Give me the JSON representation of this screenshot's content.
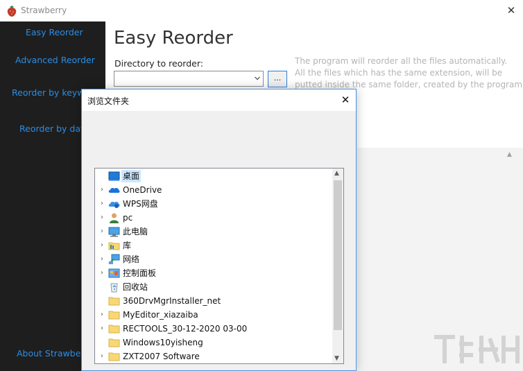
{
  "app": {
    "title": "Strawberry",
    "close_glyph": "✕"
  },
  "sidebar": {
    "items": [
      {
        "label": "Easy Reorder"
      },
      {
        "label": "Advanced Reorder"
      },
      {
        "label": "Reorder by keyword"
      },
      {
        "label": "Reorder by date"
      },
      {
        "label": "About Strawberry"
      }
    ]
  },
  "main": {
    "title": "Easy Reorder",
    "dir_label": "Directory to reorder:",
    "dir_value": "",
    "browse_label": "...",
    "info_lines": [
      "The program will reorder all the files automatically.",
      "All the files which has the same extension, will be",
      "putted inside the same folder, created by the program."
    ]
  },
  "dialog": {
    "title": "浏览文件夹",
    "close_glyph": "✕",
    "tree": [
      {
        "label": "桌面",
        "icon": "desktop-icon",
        "expandable": false,
        "selected": true
      },
      {
        "label": "OneDrive",
        "icon": "onedrive-cloud-icon",
        "expandable": true
      },
      {
        "label": "WPS网盘",
        "icon": "wps-cloud-icon",
        "expandable": true
      },
      {
        "label": "pc",
        "icon": "user-icon",
        "expandable": true
      },
      {
        "label": "此电脑",
        "icon": "computer-icon",
        "expandable": true
      },
      {
        "label": "库",
        "icon": "library-icon",
        "expandable": true
      },
      {
        "label": "网络",
        "icon": "network-icon",
        "expandable": true
      },
      {
        "label": "控制面板",
        "icon": "control-panel-icon",
        "expandable": true
      },
      {
        "label": "回收站",
        "icon": "recycle-bin-icon",
        "expandable": false
      },
      {
        "label": "360DrvMgrInstaller_net",
        "icon": "folder-icon",
        "expandable": false
      },
      {
        "label": "MyEditor_xiazaiba",
        "icon": "folder-icon",
        "expandable": true
      },
      {
        "label": "RECTOOLS_30-12-2020 03-00",
        "icon": "folder-icon",
        "expandable": true
      },
      {
        "label": "Windows10yisheng",
        "icon": "folder-icon",
        "expandable": false
      },
      {
        "label": "ZXT2007 Software",
        "icon": "folder-icon",
        "expandable": true
      }
    ]
  },
  "colors": {
    "sidebar_bg": "#1e1e1e",
    "sidebar_link": "#2b8ee6",
    "selection": "#cce8ff",
    "folder": "#f8d775"
  }
}
